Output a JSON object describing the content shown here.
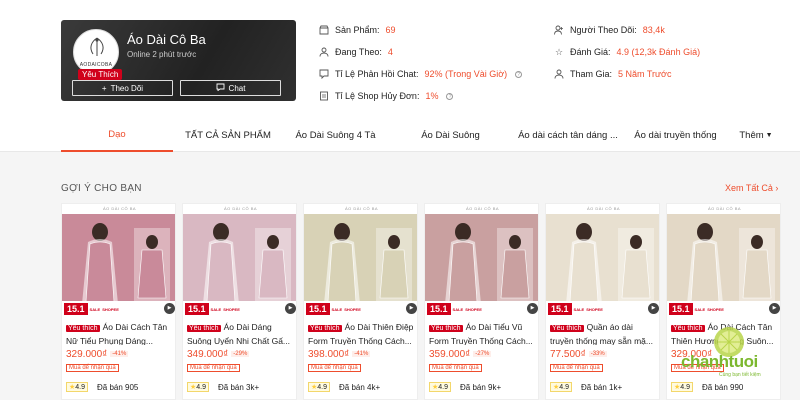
{
  "shop": {
    "name": "Áo Dài Cô Ba",
    "online": "Online 2 phút trước",
    "logo_text": "AODAICOBA",
    "badge": "Yêu Thích",
    "follow_label": "Theo Dõi",
    "chat_label": "Chat"
  },
  "stats": {
    "products_label": "Sản Phẩm:",
    "products_value": "69",
    "following_label": "Đang Theo:",
    "following_value": "4",
    "chat_rate_label": "Tỉ Lệ Phản Hồi Chat:",
    "chat_rate_value": "92% (Trong Vài Giờ)",
    "cancel_rate_label": "Tỉ Lệ Shop Hủy Đơn:",
    "cancel_rate_value": "1%",
    "followers_label": "Người Theo Dõi:",
    "followers_value": "83,4k",
    "rating_label": "Đánh Giá:",
    "rating_value": "4.9 (12,3k Đánh Giá)",
    "joined_label": "Tham Gia:",
    "joined_value": "5 Năm Trước"
  },
  "nav": {
    "tabs": [
      {
        "label": "Dạo"
      },
      {
        "label": "TẤT CẢ SẢN PHẨM"
      },
      {
        "label": "Áo Dài Suông 4 Tà"
      },
      {
        "label": "Áo Dài Suông"
      },
      {
        "label": "Áo dài cách tân dáng ..."
      },
      {
        "label": "Áo dài truyền thống"
      },
      {
        "label": "Thêm"
      }
    ]
  },
  "section": {
    "title": "GỢI Ý CHO BẠN",
    "see_all": "Xem Tất Cả"
  },
  "common": {
    "promo_151": "15.1",
    "promo_small": "SALE",
    "promo_small2": "SHOPEE",
    "fav_tag": "Yêu thích",
    "deal_tag": "Mua để nhận quà",
    "thumb_header": "ÁO DÀI CÔ BA"
  },
  "products": [
    {
      "title": "Áo Dài Cách Tân Nữ Tiểu Phụng Dáng...",
      "price": "329.000₫",
      "discount": "-41%",
      "rating": "4.9",
      "sold": "Đã bán 905",
      "color": "#c98a9a"
    },
    {
      "title": "Áo Dài Dáng Suông Uyển Nhi Chất Gấ...",
      "price": "349.000₫",
      "discount": "-29%",
      "rating": "4.9",
      "sold": "Đã bán 3k+",
      "color": "#d9b8c2"
    },
    {
      "title": "Áo Dài Thiên Điệp Form Truyền Thống Cách...",
      "price": "398.000₫",
      "discount": "-41%",
      "rating": "4.9",
      "sold": "Đã bán 4k+",
      "color": "#d8d2b6"
    },
    {
      "title": "Áo Dài Tiểu Vũ Form Truyền Thống Cách...",
      "price": "359.000₫",
      "discount": "-27%",
      "rating": "4.9",
      "sold": "Đã bán 9k+",
      "color": "#c9a0a0"
    },
    {
      "title": "Quần áo dài truyền thống may sẵn mặ...",
      "price": "77.500₫",
      "discount": "-33%",
      "rating": "4.9",
      "sold": "Đã bán 1k+",
      "color": "#e8e0d0"
    },
    {
      "title": "Áo Dài Cách Tân Thiên Hương Dáng Suôn...",
      "price": "329.000₫",
      "discount": "",
      "rating": "4.9",
      "sold": "Đã bán 990",
      "color": "#e3d8c6"
    }
  ],
  "watermark": {
    "brand": "chanhtuoi",
    "tag": "Cùng bạn tiết kiệm"
  },
  "colors": {
    "accent": "#ee4d2d",
    "badge": "#d0011b"
  }
}
